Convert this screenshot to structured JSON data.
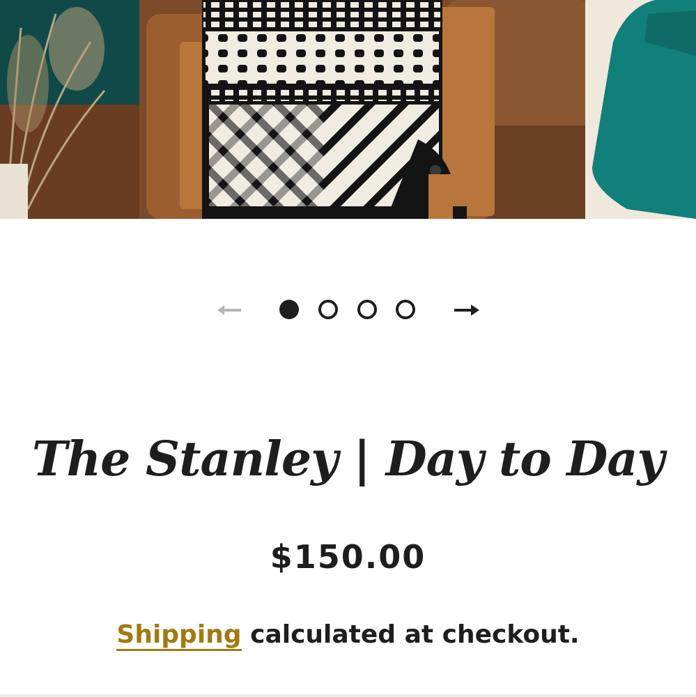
{
  "product": {
    "title": "The Stanley | Day to Day",
    "price": "$150.00",
    "shipping_link_label": "Shipping",
    "shipping_rest": " calculated at checkout.",
    "image_alt": "Aztec print backpack with leather trim on a brown leather sofa"
  },
  "carousel": {
    "prev_icon": "arrow-left-icon",
    "next_icon": "arrow-right-icon",
    "slide_count": 4,
    "active_slide": 1
  },
  "colors": {
    "text": "#1e1e1e",
    "link": "#a07a12",
    "arrow_disabled": "#b5b5b5"
  }
}
